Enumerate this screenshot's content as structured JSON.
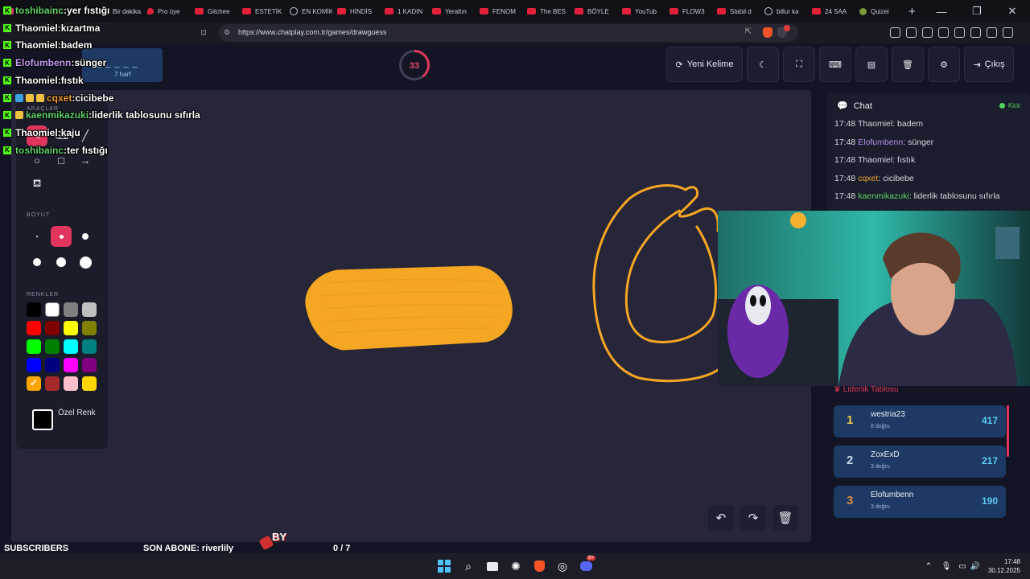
{
  "browser": {
    "tabs": [
      {
        "label": "",
        "icon": "tiktok-icon"
      },
      {
        "label": "",
        "icon": "tiktok-icon"
      },
      {
        "label": "Bir dakika",
        "icon": "tiktok-icon"
      },
      {
        "label": "Pro üye",
        "icon": "map-pin-icon"
      },
      {
        "label": "Gitchee",
        "icon": "youtube-icon"
      },
      {
        "label": "ESTETİK",
        "icon": "youtube-icon"
      },
      {
        "label": "EN KOMİK",
        "icon": "chatgpt-icon"
      },
      {
        "label": "HİNDİS",
        "icon": "youtube-icon"
      },
      {
        "label": "1 KADIN",
        "icon": "youtube-icon"
      },
      {
        "label": "Yeraltın",
        "icon": "youtube-icon"
      },
      {
        "label": "FENOM",
        "icon": "youtube-icon"
      },
      {
        "label": "The BES",
        "icon": "youtube-icon"
      },
      {
        "label": "BÖYLE",
        "icon": "youtube-icon"
      },
      {
        "label": "YouTub",
        "icon": "youtube-icon"
      },
      {
        "label": "FLOW3",
        "icon": "youtube-icon"
      },
      {
        "label": "Stabil d",
        "icon": "youtube-icon"
      },
      {
        "label": "billur ka",
        "icon": "chatgpt-icon"
      },
      {
        "label": "24 SAA",
        "icon": "youtube-icon"
      },
      {
        "label": "Quizei",
        "icon": "quiz-icon"
      }
    ],
    "new_tab": "+",
    "url": "https://www.chatplay.com.tr/games/drawguess",
    "shield_badge": "1"
  },
  "game": {
    "word_hint": "_ _ _ _ _",
    "word_length": "7 harf",
    "timer": "33",
    "timer_fraction": 0.4,
    "buttons": {
      "new_word": "Yeni Kelime",
      "exit": "Çıkış"
    }
  },
  "tools": {
    "section_tools": "ARAÇLAR",
    "section_size": "BOYUT",
    "section_colors": "RENKLER",
    "custom_color_label": "Özel Renk",
    "colors": [
      "#000000",
      "#ffffff",
      "#808080",
      "#c0c0c0",
      "#ff0000",
      "#800000",
      "#ffff00",
      "#808000",
      "#00ff00",
      "#008000",
      "#00ffff",
      "#008080",
      "#0000ff",
      "#000080",
      "#ff00ff",
      "#800080",
      "#ffa500",
      "#a52a2a",
      "#ffc0cb",
      "#ffd700"
    ],
    "selected_color": "#ffa500",
    "drawing_color": "#f5a623"
  },
  "chat": {
    "title": "Chat",
    "platform": "Kick",
    "messages": [
      {
        "time": "17:48",
        "user": "Thaomiel",
        "color": "#d6d8e2",
        "text": "badem"
      },
      {
        "time": "17:48",
        "user": "Elofumbenn",
        "color": "#b68cf0",
        "text": "sünger"
      },
      {
        "time": "17:48",
        "user": "Thaomiel",
        "color": "#d6d8e2",
        "text": "fıstık"
      },
      {
        "time": "17:48",
        "user": "cqxet",
        "color": "#f0a030",
        "text": "cicibebe"
      },
      {
        "time": "17:48",
        "user": "kaenmikazuki",
        "color": "#5ed36a",
        "text": "liderlik tablosunu sıfırla"
      }
    ]
  },
  "leaderboard": {
    "title": "Liderlik Tablosu",
    "rows": [
      {
        "rank": "1",
        "rank_color": "#f2c94c",
        "name": "westria23",
        "sub": "6 doğru",
        "score": "417"
      },
      {
        "rank": "2",
        "rank_color": "#c9d3e3",
        "name": "ZoxExD",
        "sub": "3 doğru",
        "score": "217"
      },
      {
        "rank": "3",
        "rank_color": "#d68a3c",
        "name": "Elofumbenn",
        "sub": "3 doğru",
        "score": "190"
      }
    ]
  },
  "overlay_chat": [
    {
      "user": "toshibainc",
      "color": "#5ed36a",
      "text": "yer fıstığı"
    },
    {
      "user": "Thaomiel",
      "color": "#ffffff",
      "text": "kızartma"
    },
    {
      "user": "Thaomiel",
      "color": "#ffffff",
      "text": "badem"
    },
    {
      "user": "Elofumbenn",
      "color": "#c79cf7",
      "text": "sünger"
    },
    {
      "user": "Thaomiel",
      "color": "#ffffff",
      "text": "fıstık"
    },
    {
      "user": "cqxet",
      "color": "#f0a030",
      "text": "cicibebe"
    },
    {
      "user": "kaenmikazuki",
      "color": "#5ed36a",
      "text": "liderlik tablosunu sıfırla"
    },
    {
      "user": "Thaomiel",
      "color": "#ffffff",
      "text": "kaju"
    },
    {
      "user": "toshibainc",
      "color": "#5ed36a",
      "text": "ter fıstığı"
    }
  ],
  "stream": {
    "subscribers_label": "SUBSCRIBERS",
    "last_sub": "SON ABONE: riverlily",
    "sub_goal": "0 / 7",
    "sub_progress": 0.0,
    "by_logo": "BY"
  },
  "taskbar": {
    "time": "17:48",
    "date": "30.12.2025",
    "discord_badge": "9+"
  }
}
